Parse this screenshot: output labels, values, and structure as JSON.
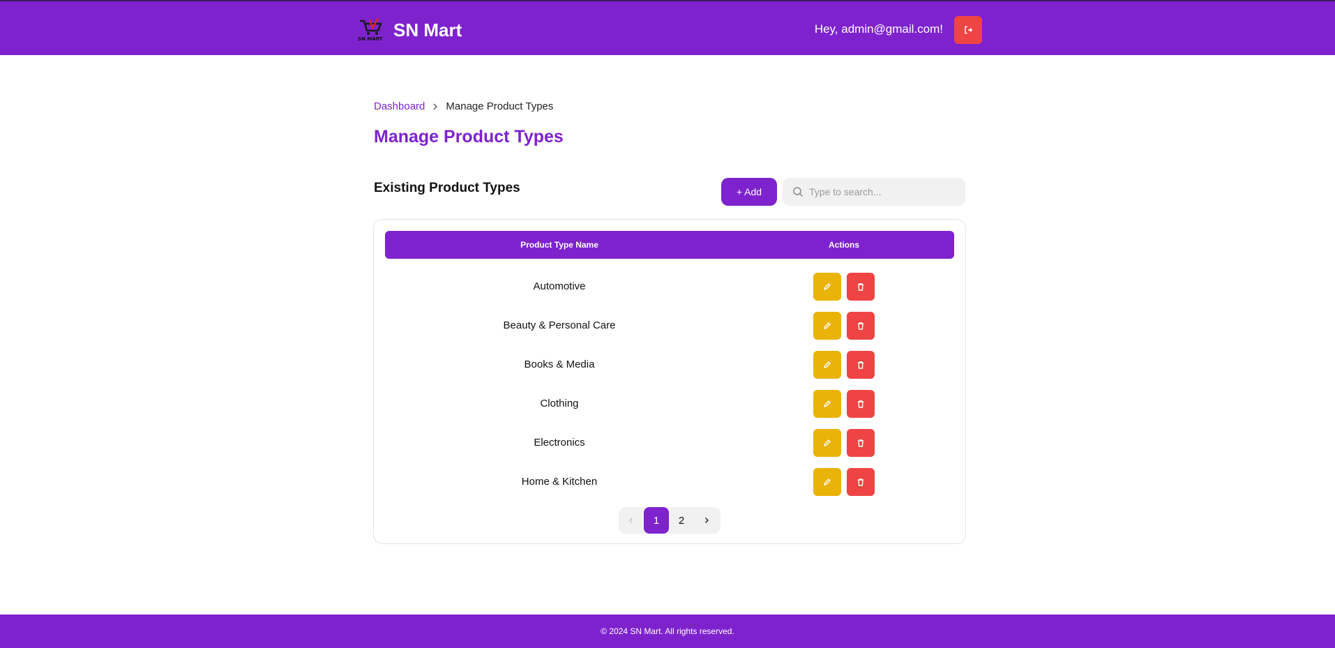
{
  "header": {
    "brand_name": "SN Mart",
    "logo_text": "SN MART",
    "greeting": "Hey, admin@gmail.com!",
    "logout_icon": "logout-icon"
  },
  "breadcrumb": {
    "home_label": "Dashboard",
    "current_label": "Manage Product Types"
  },
  "main": {
    "page_title": "Manage Product Types",
    "section_title": "Existing Product Types",
    "add_label": "+ Add",
    "search_placeholder": "Type to search..."
  },
  "table": {
    "columns": [
      "Product Type Name",
      "Actions"
    ],
    "rows": [
      {
        "name": "Automotive"
      },
      {
        "name": "Beauty & Personal Care"
      },
      {
        "name": "Books & Media"
      },
      {
        "name": "Clothing"
      },
      {
        "name": "Electronics"
      },
      {
        "name": "Home & Kitchen"
      }
    ]
  },
  "pagination": {
    "pages": [
      "1",
      "2"
    ],
    "current_page": "1"
  },
  "footer": {
    "text": "© 2024 SN Mart. All rights reserved."
  },
  "colors": {
    "brand": "#7e22ce",
    "edit": "#eab308",
    "delete": "#ef4444"
  }
}
